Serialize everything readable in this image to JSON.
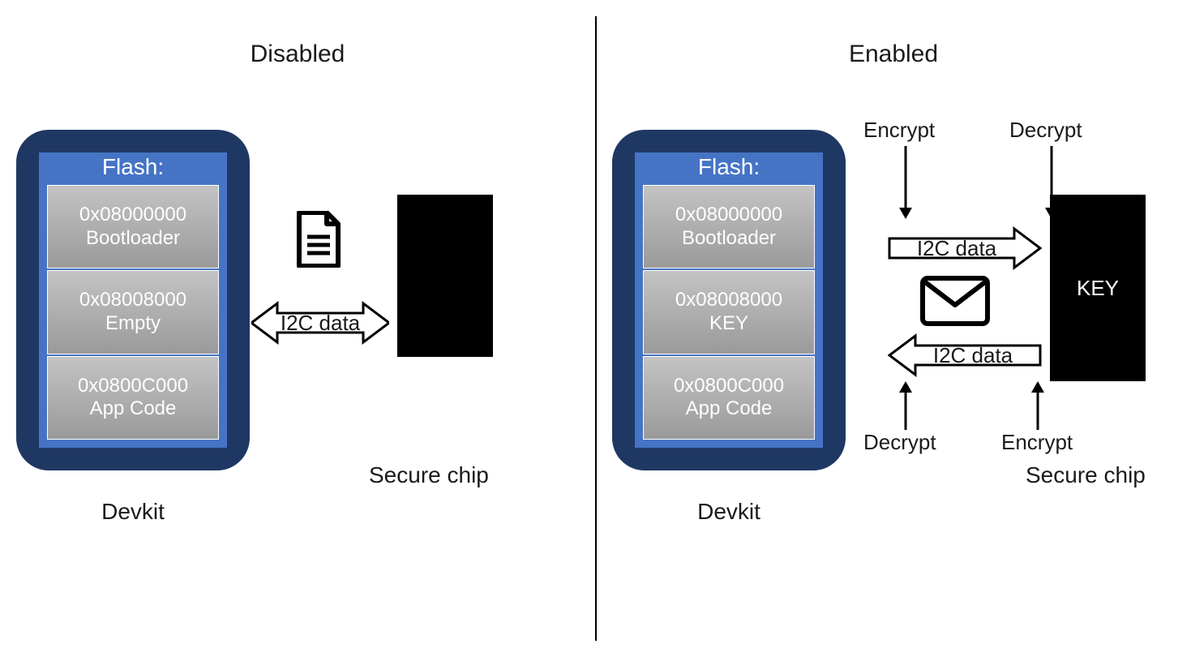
{
  "left": {
    "title": "Disabled",
    "devkit_label": "Devkit",
    "flash_header": "Flash:",
    "sections": [
      {
        "addr": "0x08000000",
        "name": "Bootloader"
      },
      {
        "addr": "0x08008000",
        "name": "Empty"
      },
      {
        "addr": "0x0800C000",
        "name": "App Code"
      }
    ],
    "arrow_label": "I2C data",
    "chip_label": "Secure chip",
    "chip_text": ""
  },
  "right": {
    "title": "Enabled",
    "devkit_label": "Devkit",
    "flash_header": "Flash:",
    "sections": [
      {
        "addr": "0x08000000",
        "name": "Bootloader"
      },
      {
        "addr": "0x08008000",
        "name": "KEY"
      },
      {
        "addr": "0x0800C000",
        "name": "App Code"
      }
    ],
    "arrow_top_label": "I2C data",
    "arrow_bot_label": "I2C data",
    "chip_label": "Secure chip",
    "chip_text": "KEY",
    "encrypt": "Encrypt",
    "decrypt": "Decrypt"
  }
}
